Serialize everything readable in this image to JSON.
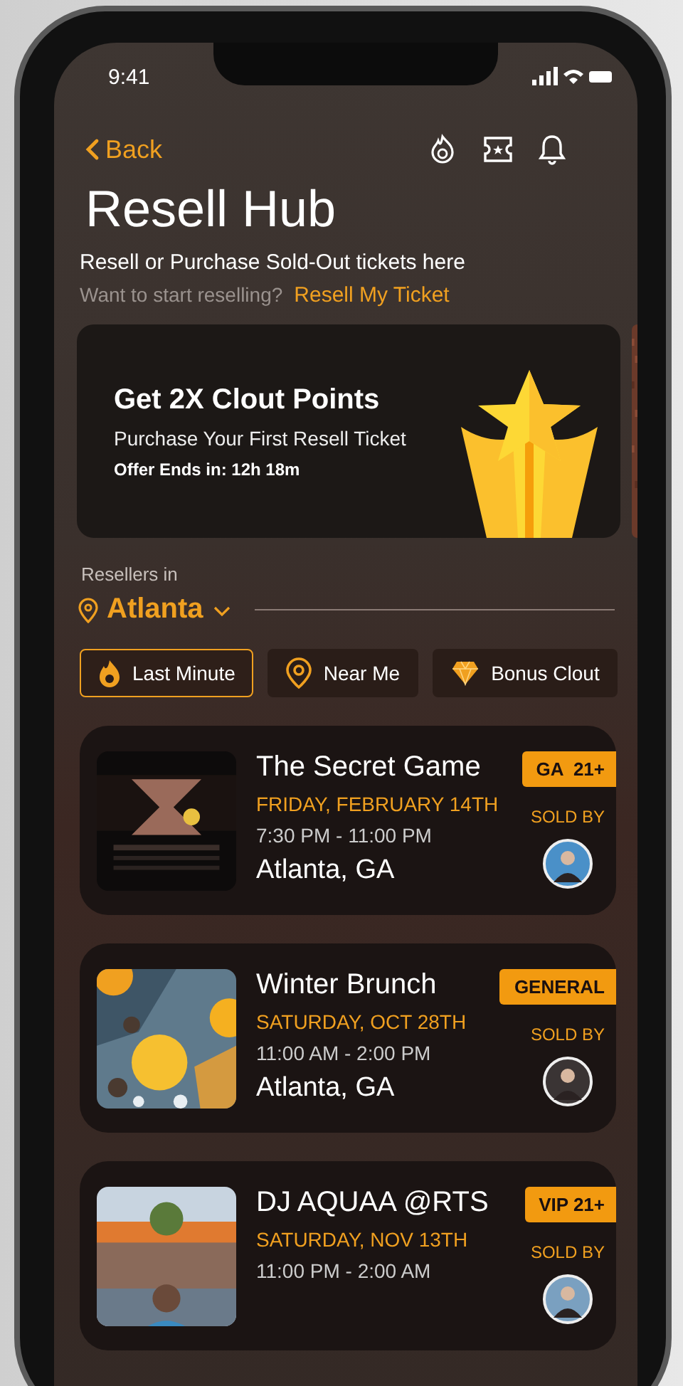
{
  "status_bar": {
    "time": "9:41"
  },
  "nav": {
    "back": "Back"
  },
  "title": "Resell Hub",
  "subtitle": "Resell or Purchase Sold-Out tickets here",
  "prompt": {
    "text": "Want to start reselling?",
    "link": "Resell My Ticket"
  },
  "promo": {
    "title": "Get 2X Clout Points",
    "subtitle": "Purchase Your First Resell Ticket",
    "offer": "Offer Ends in: 12h 18m"
  },
  "location": {
    "label": "Resellers in",
    "city": "Atlanta"
  },
  "filters": [
    {
      "label": "Last Minute",
      "kind": "flame",
      "selected": true
    },
    {
      "label": "Near Me",
      "kind": "pin",
      "selected": false
    },
    {
      "label": "Bonus Clout",
      "kind": "diamond",
      "selected": false
    }
  ],
  "events": [
    {
      "title": "The Secret Game",
      "date": "FRIDAY, FEBRUARY 14TH",
      "time": "7:30 PM - 11:00 PM",
      "location": "Atlanta, GA",
      "tag": "GA  21+",
      "sold_by": "SOLD BY"
    },
    {
      "title": "Winter Brunch",
      "date": "SATURDAY, OCT 28TH",
      "time": "11:00 AM - 2:00 PM",
      "location": "Atlanta, GA",
      "tag": "GENERAL",
      "sold_by": "SOLD BY"
    },
    {
      "title": "DJ AQUAA @RTS",
      "date": "SATURDAY, NOV 13TH",
      "time": "11:00 PM - 2:00 AM",
      "tag": "VIP 21+",
      "sold_by": "SOLD BY"
    }
  ]
}
